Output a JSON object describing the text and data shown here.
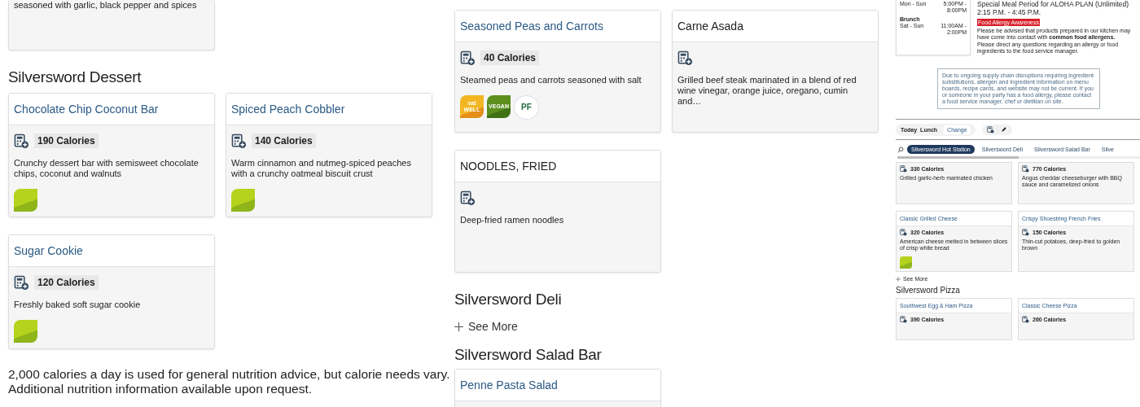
{
  "left": {
    "partial_card": {
      "description": "seasoned with garlic, black pepper and spices"
    },
    "section": {
      "heading": "Silversword Dessert",
      "items": [
        {
          "name": "Chocolate Chip Coconut Bar",
          "linked": true,
          "calories": "190 Calories",
          "description": "Crunchy dessert bar with semisweet chocolate chips, coconut and walnuts",
          "badges": [
            {
              "kind": "vegetarian"
            }
          ]
        },
        {
          "name": "Spiced Peach Cobbler",
          "linked": true,
          "calories": "140 Calories",
          "description": "Warm cinnamon and nutmeg-spiced peaches with a crunchy oatmeal biscuit crust",
          "badges": [
            {
              "kind": "vegetarian"
            }
          ]
        },
        {
          "name": "Sugar Cookie",
          "linked": true,
          "calories": "120 Calories",
          "description": "Freshly baked soft sugar cookie",
          "badges": [
            {
              "kind": "vegetarian"
            }
          ]
        }
      ]
    },
    "footnote": [
      "2,000 calories a day is used for general nutrition advice, but calorie needs vary.",
      "Additional nutrition information available upon request."
    ]
  },
  "middle": {
    "items": [
      {
        "name": "Seasoned Peas and Carrots",
        "linked": true,
        "calories": "40 Calories",
        "description": "Steamed peas and carrots seasoned with salt",
        "badges": [
          {
            "kind": "eatwell",
            "label": "eat WELL"
          },
          {
            "kind": "vegan",
            "label": "VEGAN"
          },
          {
            "kind": "plant_forward",
            "label": "PF"
          }
        ]
      },
      {
        "name": "Carne Asada",
        "linked": false,
        "description": "Grilled beef steak marinated in a blend of red wine vinegar, orange juice, oregano, cumin and…"
      },
      {
        "name": "NOODLES, FRIED",
        "linked": false,
        "description": "Deep-fried ramen noodles"
      }
    ],
    "deli": {
      "heading": "Silversword Deli",
      "see_more": "See More"
    },
    "salad_bar": {
      "heading": "Silversword Salad Bar",
      "items": [
        {
          "name": "Penne Pasta Salad",
          "linked": true
        }
      ]
    }
  },
  "right": {
    "hours": [
      {
        "days": "Mon - Sun",
        "time": "5:00PM - 8:00PM"
      },
      {
        "meal": "Brunch",
        "days": "Sat - Sun",
        "time": "11:00AM - 2:00PM"
      }
    ],
    "special": {
      "title": "Special Meal Period for ALOHA PLAN (Unlimited)",
      "time": "2:15 P.M. - 4:45 P.M."
    },
    "allergy": {
      "label": "Food Allergy Awareness",
      "paragraphs": [
        "Please be advised that products prepared in our kitchen may have come into contact with **common food allergens.**",
        "Please direct any questions regarding an allergy or food ingredients to the food service manager."
      ]
    },
    "notice": "Due to ongoing supply chain disruptions requiring ingredient substitutions, allergen and ingredient information on menu boards, recipe cards, and website may not be current. If you or someone in your party has a food allergy, please contact a food service manager, chef or dietitian on site.",
    "period": {
      "day": "Today",
      "meal": "Lunch",
      "change": "Change"
    },
    "tabs": [
      {
        "label": "Silversword Hot Station",
        "selected": true
      },
      {
        "label": "Silversword Deli",
        "selected": false
      },
      {
        "label": "Silversword Salad Bar",
        "selected": false
      },
      {
        "label": "Silve",
        "selected": false
      }
    ],
    "items": [
      {
        "calories": "330 Calories",
        "description": "Grilled garlic-herb marinated chicken"
      },
      {
        "calories": "770 Calories",
        "description": "Angus cheddar cheeseburger with BBQ sauce and caramelized onions"
      },
      {
        "name": "Classic Grilled Cheese",
        "calories": "320 Calories",
        "description": "American cheese melted in between slices of crisp white bread",
        "badges": [
          {
            "kind": "vegetarian"
          }
        ]
      },
      {
        "name": "Crispy Shoestring French Fries",
        "calories": "150 Calories",
        "description": "Thin-cut potatoes, deep-fried to golden brown"
      }
    ],
    "see_more": "See More",
    "pizza": {
      "heading": "Silversword Pizza",
      "items": [
        {
          "name": "Southwest Egg & Ham Pizza",
          "calories": "390 Calories"
        },
        {
          "name": "Classic Cheese Pizza",
          "calories": "260 Calories"
        }
      ]
    }
  }
}
